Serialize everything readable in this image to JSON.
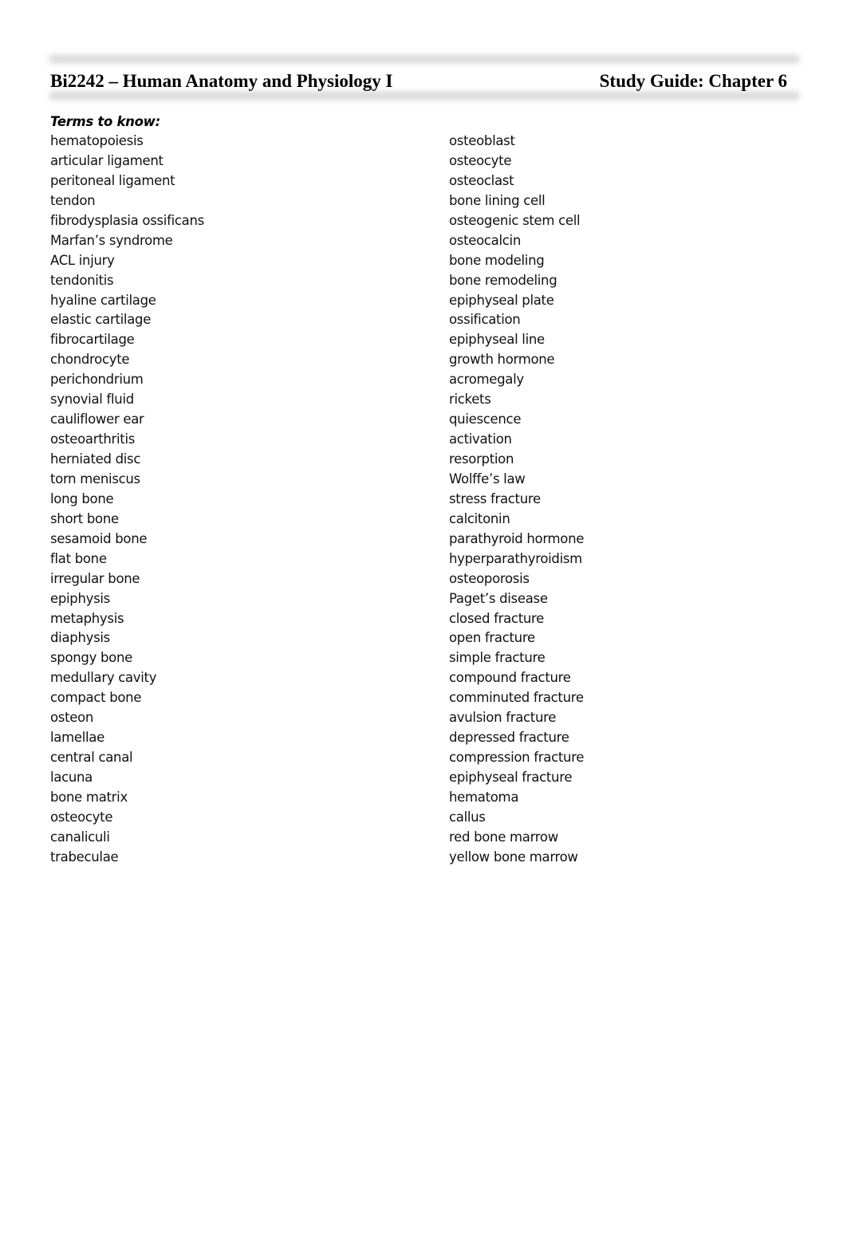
{
  "header": {
    "course_title": "Bi2242 – Human Anatomy and Physiology I",
    "guide_title": "Study Guide: Chapter 6"
  },
  "terms": {
    "heading": "Terms to know:",
    "left_column": [
      "hematopoiesis",
      "articular ligament",
      "peritoneal ligament",
      "tendon",
      "fibrodysplasia ossificans",
      "Marfan’s syndrome",
      "ACL injury",
      "tendonitis",
      "hyaline cartilage",
      "elastic cartilage",
      "fibrocartilage",
      "chondrocyte",
      "perichondrium",
      "synovial fluid",
      "cauliflower ear",
      "osteoarthritis",
      "herniated disc",
      "torn meniscus",
      "long bone",
      "short bone",
      "sesamoid bone",
      "flat bone",
      "irregular bone",
      "epiphysis",
      "metaphysis",
      "diaphysis",
      "spongy bone",
      "medullary cavity",
      "compact bone",
      "osteon",
      "lamellae",
      "central canal",
      "lacuna",
      "bone matrix",
      "osteocyte",
      "canaliculi",
      "trabeculae"
    ],
    "right_column": [
      "osteoblast",
      "osteocyte",
      "osteoclast",
      "bone lining cell",
      "osteogenic stem cell",
      "osteocalcin",
      "bone modeling",
      "bone remodeling",
      "epiphyseal plate",
      "ossification",
      "epiphyseal line",
      "growth hormone",
      "acromegaly",
      "rickets",
      "quiescence",
      "activation",
      "resorption",
      "Wolffe’s law",
      "stress fracture",
      "calcitonin",
      "parathyroid hormone",
      "hyperparathyroidism",
      "osteoporosis",
      "Paget’s disease",
      "closed fracture",
      "open fracture",
      "simple fracture",
      "compound fracture",
      "comminuted fracture",
      "avulsion fracture",
      "depressed fracture",
      "compression fracture",
      "epiphyseal fracture",
      "hematoma",
      "callus",
      "red bone marrow",
      "yellow bone marrow"
    ]
  }
}
